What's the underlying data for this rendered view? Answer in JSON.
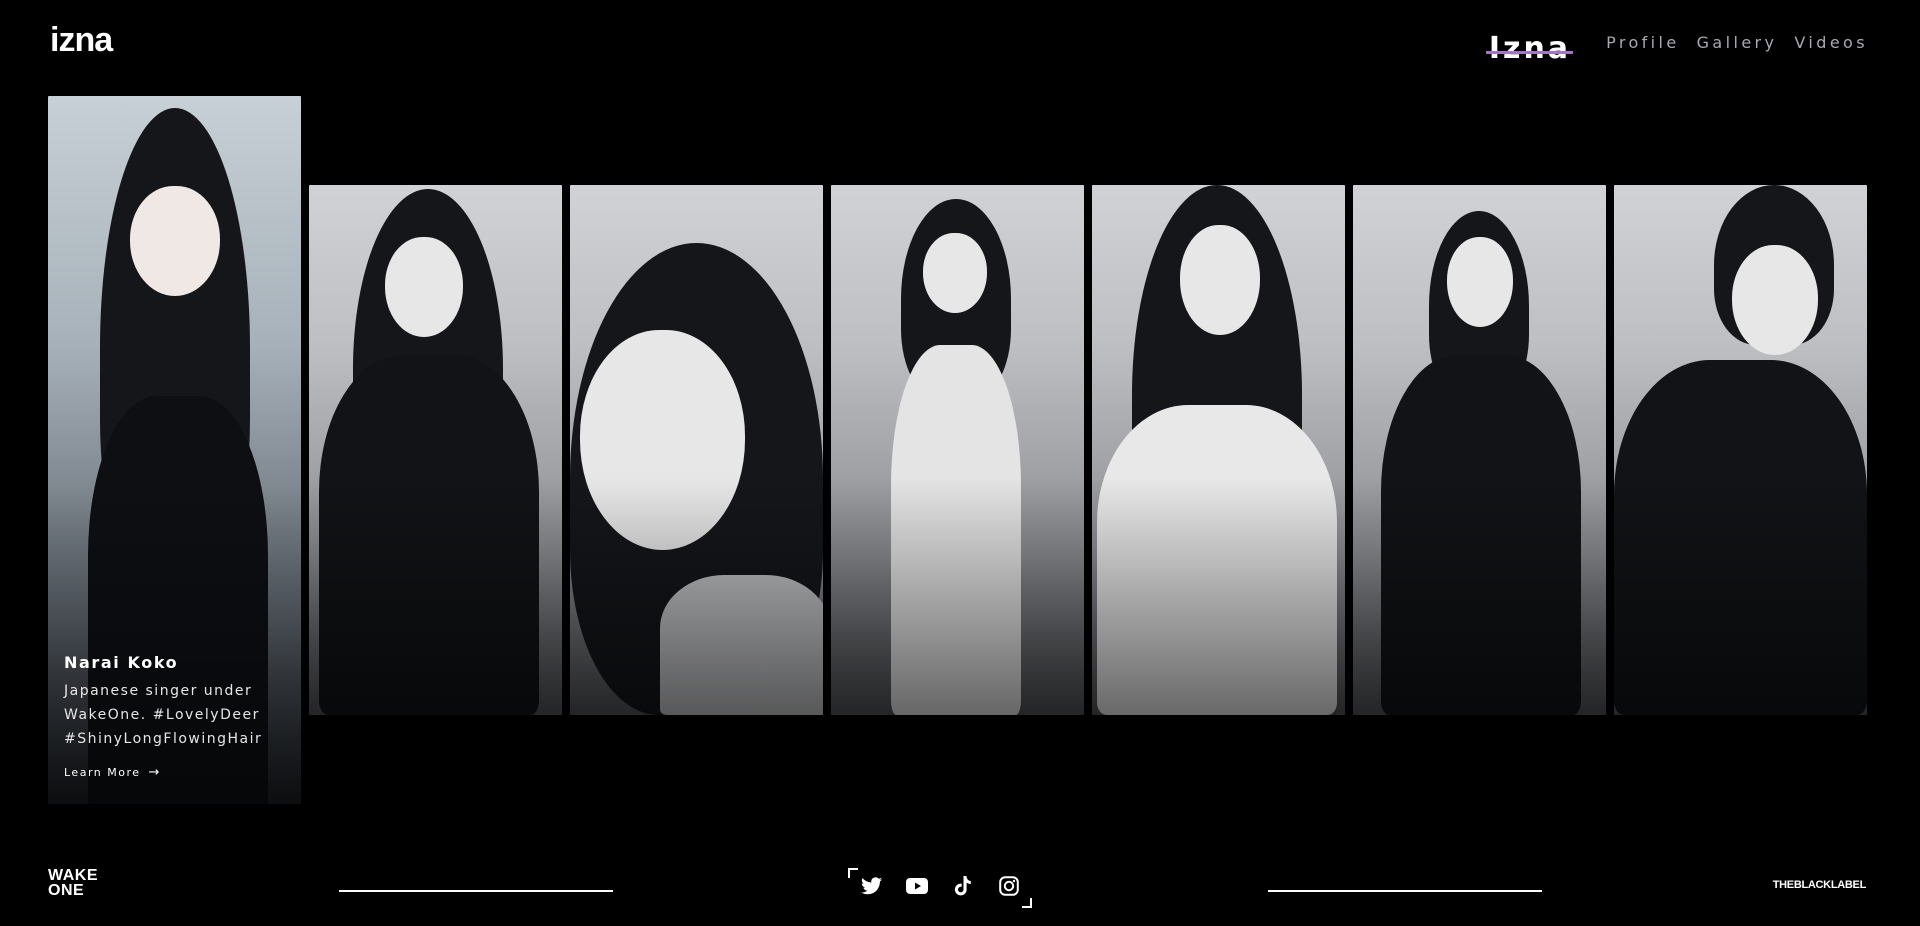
{
  "header": {
    "logo": "izna",
    "brand": "Izna",
    "nav": [
      "Profile",
      "Gallery",
      "Videos"
    ]
  },
  "featured": {
    "name": "Narai Koko",
    "description": "Japanese singer under WakeOne. #LovelyDeer #ShinyLongFlowingHair",
    "cta": "Learn More"
  },
  "gallery_images": [
    "member-photo-1",
    "member-photo-2",
    "member-photo-3",
    "member-photo-4",
    "member-photo-5",
    "member-photo-6",
    "member-photo-7"
  ],
  "footer": {
    "left_logo_line1": "WAKE",
    "left_logo_line2": "ONE",
    "right_logo": "THEBLACKLABEL",
    "socials": [
      "twitter-icon",
      "youtube-icon",
      "tiktok-icon",
      "instagram-icon"
    ]
  },
  "colors": {
    "accent": "#a774c4",
    "nav_text": "#a9a9b0",
    "background": "#000000"
  }
}
